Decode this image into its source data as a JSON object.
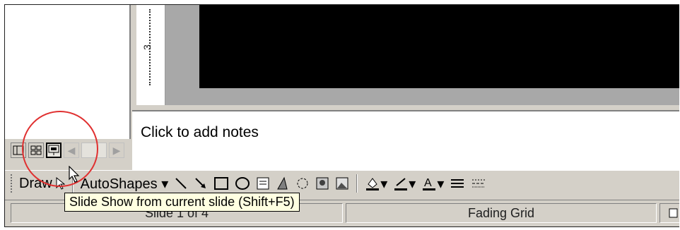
{
  "notes": {
    "placeholder": "Click to add notes"
  },
  "ruler": {
    "marker": "3"
  },
  "view_buttons": {
    "normal_icon": "normal-view-icon",
    "sorter_icon": "slide-sorter-icon",
    "slideshow_icon": "slide-show-icon"
  },
  "drawing_toolbar": {
    "draw_label": "Draw",
    "autoshapes_label": "AutoShapes ▾"
  },
  "tooltip": {
    "text": "Slide Show from current slide (Shift+F5)"
  },
  "status": {
    "slide_info": "Slide 1 of 4",
    "design": "Fading Grid"
  },
  "colors": {
    "highlight_circle": "#e03030",
    "tooltip_bg": "#ffffe1",
    "slide_bg": "#000000"
  }
}
